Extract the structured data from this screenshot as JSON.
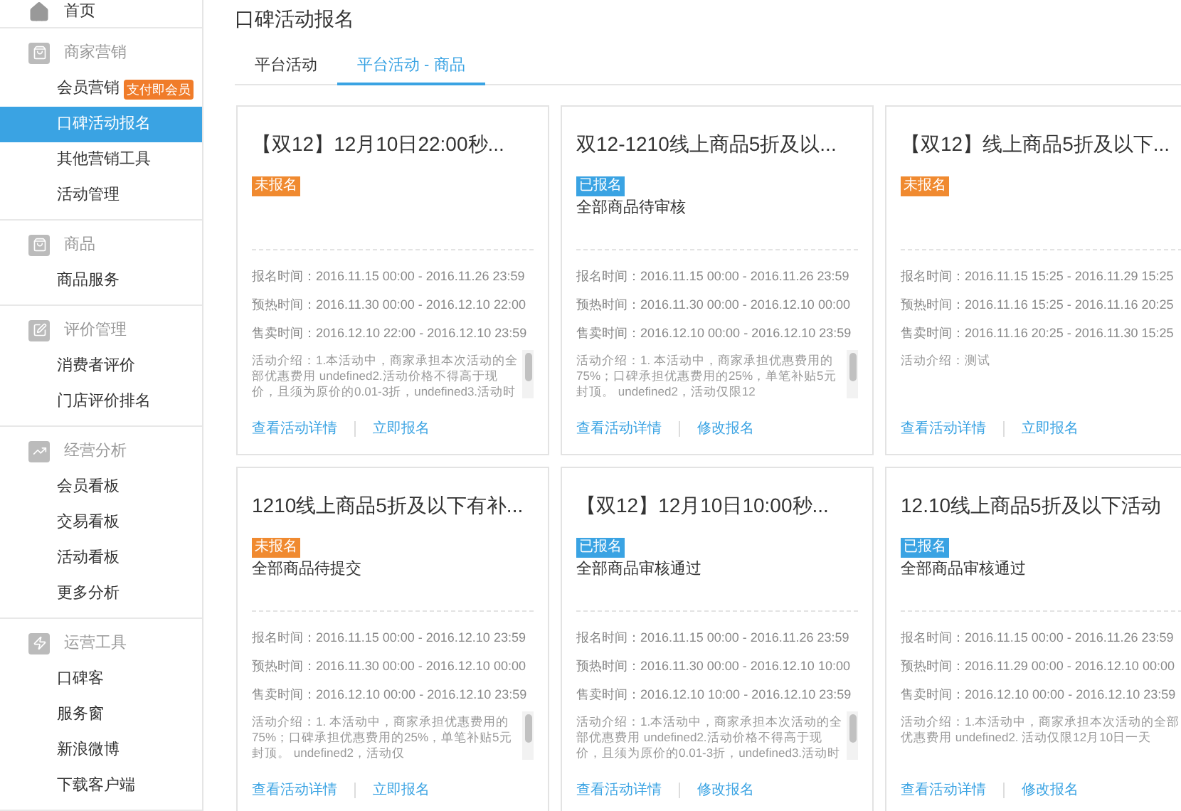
{
  "sidebar": {
    "home": {
      "label": "首页"
    },
    "sections": [
      {
        "title": "商家营销",
        "items": [
          {
            "label": "会员营销",
            "badge": "支付即会员",
            "selected": false
          },
          {
            "label": "口碑活动报名",
            "selected": true
          },
          {
            "label": "其他营销工具",
            "selected": false
          },
          {
            "label": "活动管理",
            "selected": false
          }
        ]
      },
      {
        "title": "商品",
        "items": [
          {
            "label": "商品服务",
            "selected": false
          }
        ]
      },
      {
        "title": "评价管理",
        "items": [
          {
            "label": "消费者评价",
            "selected": false
          },
          {
            "label": "门店评价排名",
            "selected": false
          }
        ]
      },
      {
        "title": "经营分析",
        "items": [
          {
            "label": "会员看板",
            "selected": false
          },
          {
            "label": "交易看板",
            "selected": false
          },
          {
            "label": "活动看板",
            "selected": false
          },
          {
            "label": "更多分析",
            "selected": false
          }
        ]
      },
      {
        "title": "运营工具",
        "items": [
          {
            "label": "口碑客",
            "selected": false
          },
          {
            "label": "服务窗",
            "selected": false
          },
          {
            "label": "新浪微博",
            "selected": false
          },
          {
            "label": "下载客户端",
            "selected": false
          }
        ]
      }
    ]
  },
  "page": {
    "title": "口碑活动报名"
  },
  "tabs": [
    {
      "label": "平台活动",
      "selected": false
    },
    {
      "label": "平台活动 - 商品",
      "selected": true
    }
  ],
  "cards": [
    {
      "title": "【双12】12月10日22:00秒...",
      "registered": false,
      "status": "未报名",
      "times": [
        {
          "label": "报名时间：",
          "value": "2016.11.15 00:00 - 2016.11.26 23:59"
        },
        {
          "label": "预热时间：",
          "value": "2016.11.30 00:00 - 2016.12.10 22:00"
        },
        {
          "label": "售卖时间：",
          "value": "2016.12.10 22:00 - 2016.12.10 23:59"
        }
      ],
      "intro": "活动介绍：1.本活动中，商家承担本次活动的全部优惠费用 undefined2.活动价格不得高于现价，且须为原价的0.01-3折，undefined3.活动时",
      "scrollable": true,
      "links": [
        "查看活动详情",
        "立即报名"
      ]
    },
    {
      "title": "双12-1210线上商品5折及以...",
      "registered": true,
      "status": "已报名",
      "review": "全部商品待审核",
      "times": [
        {
          "label": "报名时间：",
          "value": "2016.11.15 00:00 - 2016.11.26 23:59"
        },
        {
          "label": "预热时间：",
          "value": "2016.11.30 00:00 - 2016.12.10 00:00"
        },
        {
          "label": "售卖时间：",
          "value": "2016.12.10 00:00 - 2016.12.10 23:59"
        }
      ],
      "intro": "活动介绍：1. 本活动中，商家承担优惠费用的75%；口碑承担优惠费用的25%，单笔补贴5元封顶。 undefined2，活动仅限12",
      "scrollable": true,
      "links": [
        "查看活动详情",
        "修改报名"
      ]
    },
    {
      "title": "【双12】线上商品5折及以下...",
      "registered": false,
      "status": "未报名",
      "times": [
        {
          "label": "报名时间：",
          "value": "2016.11.15 15:25 - 2016.11.29 15:25"
        },
        {
          "label": "预热时间：",
          "value": "2016.11.16 15:25 - 2016.11.16 20:25"
        },
        {
          "label": "售卖时间：",
          "value": "2016.11.16 20:25 - 2016.11.30 15:25"
        }
      ],
      "intro": "活动介绍：测试",
      "scrollable": false,
      "links": [
        "查看活动详情",
        "立即报名"
      ]
    },
    {
      "title": "1210线上商品5折及以下有补...",
      "registered": false,
      "status": "未报名",
      "review": "全部商品待提交",
      "times": [
        {
          "label": "报名时间：",
          "value": "2016.11.15 00:00 - 2016.12.10 23:59"
        },
        {
          "label": "预热时间：",
          "value": "2016.11.30 00:00 - 2016.12.10 00:00"
        },
        {
          "label": "售卖时间：",
          "value": "2016.12.10 00:00 - 2016.12.10 23:59"
        }
      ],
      "intro": "活动介绍：1. 本活动中，商家承担优惠费用的75%；口碑承担优惠费用的25%，单笔补贴5元封顶。 undefined2，活动仅",
      "scrollable": true,
      "links": [
        "查看活动详情",
        "立即报名"
      ]
    },
    {
      "title": "【双12】12月10日10:00秒...",
      "registered": true,
      "status": "已报名",
      "review": "全部商品审核通过",
      "times": [
        {
          "label": "报名时间：",
          "value": "2016.11.15 00:00 - 2016.11.26 23:59"
        },
        {
          "label": "预热时间：",
          "value": "2016.11.30 00:00 - 2016.12.10 10:00"
        },
        {
          "label": "售卖时间：",
          "value": "2016.12.10 10:00 - 2016.12.10 23:59"
        }
      ],
      "intro": "活动介绍：1.本活动中，商家承担本次活动的全部优惠费用 undefined2.活动价格不得高于现价，且须为原价的0.01-3折，undefined3.活动时",
      "scrollable": true,
      "links": [
        "查看活动详情",
        "修改报名"
      ]
    },
    {
      "title": "12.10线上商品5折及以下活动",
      "registered": true,
      "status": "已报名",
      "review": "全部商品审核通过",
      "times": [
        {
          "label": "报名时间：",
          "value": "2016.11.15 00:00 - 2016.11.26 23:59"
        },
        {
          "label": "预热时间：",
          "value": "2016.11.29 00:00 - 2016.12.10 00:00"
        },
        {
          "label": "售卖时间：",
          "value": "2016.12.10 00:00 - 2016.12.10 23:59"
        }
      ],
      "intro": "活动介绍：1.本活动中，商家承担本次活动的全部优惠费用 undefined2. 活动仅限12月10日一天",
      "scrollable": false,
      "links": [
        "查看活动详情",
        "修改报名"
      ]
    }
  ]
}
